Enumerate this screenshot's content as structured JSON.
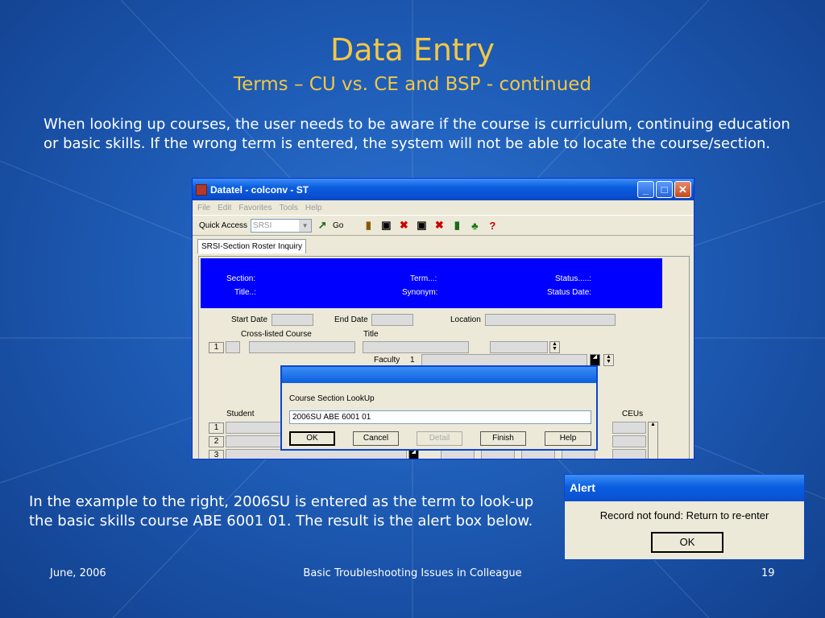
{
  "slide": {
    "title": "Data Entry",
    "subtitle": "Terms – CU vs. CE and BSP - continued",
    "paragraph1": "When looking up courses, the user needs to be aware if the course is curriculum, continuing education or basic skills.  If the wrong term is entered, the system will not be able to locate the course/section.",
    "paragraph2": "In the example to the right, 2006SU is entered as the term to look-up the basic skills course ABE 6001 01. The result is the alert box below.",
    "footer_left": "June, 2006",
    "footer_center": "Basic Troubleshooting Issues in Colleague",
    "footer_right": "19"
  },
  "window": {
    "title": "Datatel - colconv - ST",
    "menu": [
      "File",
      "Edit",
      "Favorites",
      "Tools",
      "Help"
    ],
    "quick_access_label": "Quick Access",
    "quick_access_value": "SRSI",
    "go_label": "Go",
    "tab_label": "SRSI-Section Roster Inquiry",
    "header": {
      "section": "Section:",
      "title": "Title..:",
      "term": "Term...:",
      "synonym": "Synonym:",
      "status": "Status.....:",
      "status_date": "Status Date:"
    },
    "form": {
      "start_date": "Start Date",
      "end_date": "End Date",
      "location": "Location",
      "cross_listed": "Cross-listed Course",
      "title": "Title",
      "faculty": "Faculty",
      "faculty_num": "1",
      "row1": "1",
      "student": "Student",
      "ceus": "CEUs",
      "rows": [
        "1",
        "2",
        "3"
      ]
    }
  },
  "dialog": {
    "label": "Course Section LookUp",
    "value": "2006SU ABE 6001 01",
    "buttons": {
      "ok": "OK",
      "cancel": "Cancel",
      "detail": "Detail",
      "finish": "Finish",
      "help": "Help"
    }
  },
  "alert": {
    "title": "Alert",
    "message": "Record not found:  Return to re-enter",
    "ok": "OK"
  }
}
